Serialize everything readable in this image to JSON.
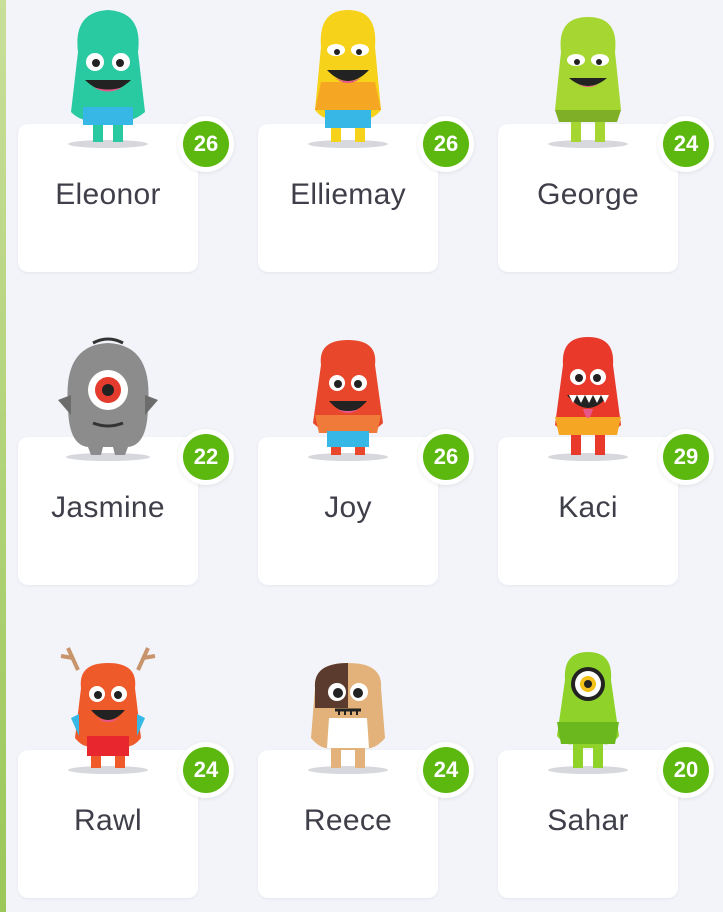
{
  "students": [
    {
      "name": "Eleonor",
      "points": "26",
      "avatar": "teal-monster-icon",
      "color": "#29c9a1"
    },
    {
      "name": "Elliemay",
      "points": "26",
      "avatar": "yellow-monster-icon",
      "color": "#f7d21a"
    },
    {
      "name": "George",
      "points": "24",
      "avatar": "lime-monster-icon",
      "color": "#a6d632"
    },
    {
      "name": "Jasmine",
      "points": "22",
      "avatar": "gray-one-eyed-monster-icon",
      "color": "#8c8c8c"
    },
    {
      "name": "Joy",
      "points": "26",
      "avatar": "red-monster-icon",
      "color": "#e8472b"
    },
    {
      "name": "Kaci",
      "points": "29",
      "avatar": "red-toothy-monster-icon",
      "color": "#e8392b"
    },
    {
      "name": "Rawl",
      "points": "24",
      "avatar": "orange-antlered-monster-icon",
      "color": "#ef5a2a"
    },
    {
      "name": "Reece",
      "points": "24",
      "avatar": "patchwork-monster-icon",
      "color": "#d8a56a"
    },
    {
      "name": "Sahar",
      "points": "20",
      "avatar": "green-one-eyed-monster-icon",
      "color": "#8fd22a"
    }
  ],
  "accent_color": "#5cb80f"
}
